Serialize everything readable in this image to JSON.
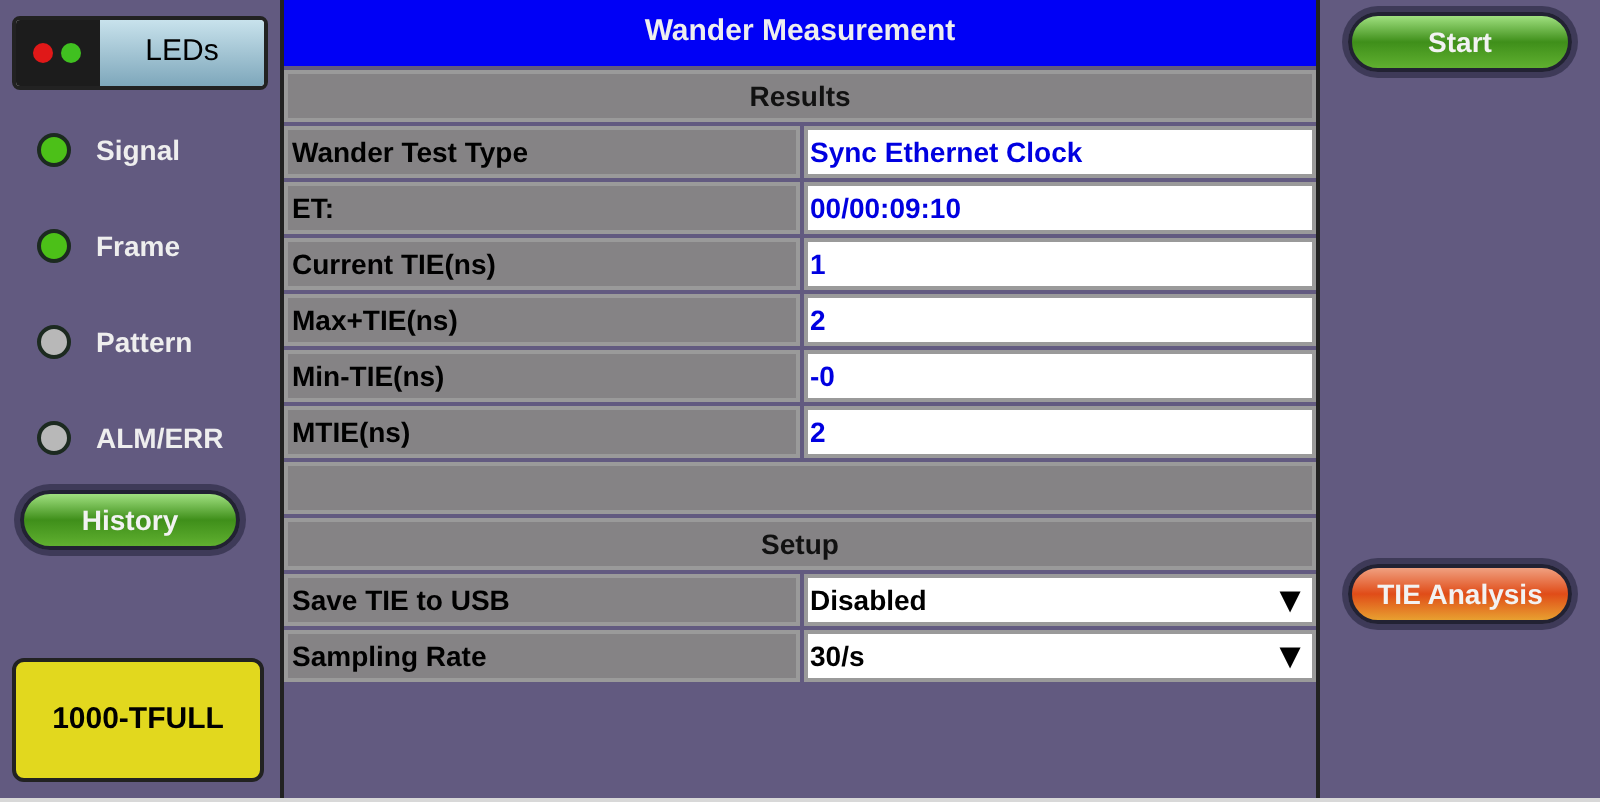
{
  "leds_button": {
    "label": "LEDs"
  },
  "leds": [
    {
      "label": "Signal",
      "on": true
    },
    {
      "label": "Frame",
      "on": true
    },
    {
      "label": "Pattern",
      "on": false
    },
    {
      "label": "ALM/ERR",
      "on": false
    }
  ],
  "history_button": "History",
  "port_button": "1000-TFULL",
  "title": "Wander Measurement",
  "results": {
    "heading": "Results",
    "rows": [
      {
        "label": "Wander Test Type",
        "value": "Sync Ethernet Clock"
      },
      {
        "label": "ET:",
        "value": "00/00:09:10"
      },
      {
        "label": "Current TIE(ns)",
        "value": "1"
      },
      {
        "label": "Max+TIE(ns)",
        "value": "2"
      },
      {
        "label": "Min-TIE(ns)",
        "value": "-0"
      },
      {
        "label": "MTIE(ns)",
        "value": "2"
      }
    ]
  },
  "setup": {
    "heading": "Setup",
    "rows": [
      {
        "label": "Save TIE to USB",
        "value": "Disabled",
        "caret": "▼"
      },
      {
        "label": "Sampling Rate",
        "value": "30/s",
        "caret": "▼"
      }
    ]
  },
  "start_button": "Start",
  "analysis_button": "TIE Analysis"
}
